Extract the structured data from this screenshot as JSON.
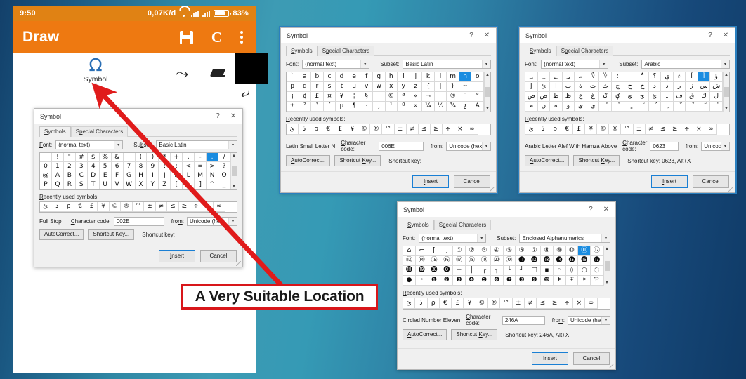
{
  "phone": {
    "status_bar": {
      "time": "9:50",
      "data_rate": "0,07K/d",
      "battery": "83%",
      "icons": [
        "wifi-icon",
        "signal-icon",
        "signal-icon",
        "battery-icon"
      ]
    },
    "app_bar": {
      "title": "Draw",
      "actions": [
        {
          "name": "save-icon"
        },
        {
          "name": "letter-c-icon",
          "label": "C"
        },
        {
          "name": "overflow-menu-icon"
        }
      ]
    },
    "toolbar": {
      "symbol_tool": {
        "glyph": "Ω",
        "label": "Symbol",
        "caret": "▾"
      },
      "redo": "⤳",
      "undo": "⤶",
      "eraser": "eraser-icon",
      "color_swatch": "#000000"
    }
  },
  "callout": {
    "text": "A Very Suitable Location",
    "border_color": "#d8161a",
    "arrow_color": "#e01b1b"
  },
  "dialog_common": {
    "title": "Symbol",
    "help_btn": "?",
    "close_btn": "✕",
    "tabs": [
      "Symbols",
      "Special Characters"
    ],
    "font_label": "Font:",
    "font_value": "(normal text)",
    "subset_label": "Subset:",
    "recently_used_label": "Recently used symbols:",
    "char_code_label": "Character code:",
    "from_label": "from:",
    "from_value": "Unicode (hex)",
    "autocorrect_btn": "AutoCorrect...",
    "shortcut_key_btn": "Shortcut Key...",
    "insert_btn": "Insert",
    "cancel_btn": "Cancel",
    "recently_used": [
      "ئ",
      "ذ",
      "ρ",
      "€",
      "£",
      "¥",
      "©",
      "®",
      "™",
      "±",
      "≠",
      "≤",
      "≥",
      "÷",
      "×",
      "∞"
    ]
  },
  "dialogs": [
    {
      "id": "dlg1",
      "subset_value": "Basic Latin",
      "columns": 16,
      "grid": [
        " ",
        "!",
        "\"",
        "#",
        "$",
        "%",
        "&",
        "'",
        "(",
        ")",
        "*",
        "+",
        ",",
        "-",
        ".",
        "/",
        "0",
        "1",
        "2",
        "3",
        "4",
        "5",
        "6",
        "7",
        "8",
        "9",
        ":",
        ";",
        "<",
        "=",
        ">",
        "?",
        "@",
        "A",
        "B",
        "C",
        "D",
        "E",
        "F",
        "G",
        "H",
        "I",
        "J",
        "K",
        "L",
        "M",
        "N",
        "O",
        "P",
        "Q",
        "R",
        "S",
        "T",
        "U",
        "V",
        "W",
        "X",
        "Y",
        "Z",
        "[",
        "\\",
        "]",
        "^",
        "_"
      ],
      "selected_index": 14,
      "char_name": "Full Stop",
      "char_code": "002E",
      "shortcut_key_label": "Shortcut key:"
    },
    {
      "id": "dlg2",
      "subset_value": "Basic Latin",
      "columns": 16,
      "grid": [
        "`",
        "a",
        "b",
        "c",
        "d",
        "e",
        "f",
        "g",
        "h",
        "i",
        "j",
        "k",
        "l",
        "m",
        "n",
        "o",
        "p",
        "q",
        "r",
        "s",
        "t",
        "u",
        "v",
        "w",
        "x",
        "y",
        "z",
        "{",
        "|",
        "}",
        "~",
        " ",
        "¡",
        "¢",
        "£",
        "¤",
        "¥",
        "¦",
        "§",
        "¨",
        "©",
        "ª",
        "«",
        "¬",
        "­",
        "®",
        "¯",
        "°",
        "±",
        "²",
        "³",
        "´",
        "µ",
        "¶",
        "·",
        "¸",
        "¹",
        "º",
        "»",
        "¼",
        "½",
        "¾",
        "¿",
        "À"
      ],
      "selected_index": 14,
      "char_name": "Latin Small Letter N",
      "char_code": "006E",
      "shortcut_key_label": "Shortcut key:"
    },
    {
      "id": "dlg3",
      "subset_value": "Arabic",
      "columns": 16,
      "grid": [
        "؀",
        "؁",
        "؂",
        "؃",
        "؄",
        "؆",
        "؇",
        "؛",
        "؜",
        "؞",
        "؟",
        "ؠ",
        "ء",
        "آ",
        "أ",
        "ؤ",
        "إ",
        "ئ",
        "ا",
        "ب",
        "ة",
        "ت",
        "ث",
        "ج",
        "ح",
        "خ",
        "د",
        "ذ",
        "ر",
        "ز",
        "س",
        "ش",
        "ص",
        "ض",
        "ط",
        "ظ",
        "ع",
        "غ",
        "ػ",
        "ؼ",
        "ؽ",
        "ؾ",
        "ؿ",
        "ـ",
        "ف",
        "ق",
        "ك",
        "ل",
        "م",
        "ن",
        "ه",
        "و",
        "ى",
        "ي",
        "ً",
        "ٌ",
        "ٍ",
        "َ",
        "ُ",
        "ِ",
        "ّ",
        "ْ",
        "ٓ",
        "ٔ"
      ],
      "selected_index": 14,
      "char_name": "Arabic Letter Alef With Hamza Above",
      "char_code": "0623",
      "shortcut_key_label": "Shortcut key: 0623, Alt+X"
    },
    {
      "id": "dlg4",
      "subset_value": "Enclosed Alphanumerics",
      "columns": 16,
      "grid": [
        "⌂",
        "⌐",
        "⌈",
        "⌋",
        "①",
        "②",
        "③",
        "④",
        "⑤",
        "⑥",
        "⑦",
        "⑧",
        "⑨",
        "⑩",
        "⑪",
        "⑫",
        "⑬",
        "⑭",
        "⑮",
        "⑯",
        "⑰",
        "⑱",
        "⑲",
        "⑳",
        "⓪",
        "⓫",
        "⓬",
        "⓭",
        "⓮",
        "⓯",
        "⓰",
        "⓱",
        "⓲",
        "⓳",
        "⓴",
        "⓿",
        "─",
        "│",
        "┌",
        "┐",
        "└",
        "┘",
        "□",
        "▪",
        "◦",
        "◊",
        "○",
        "◌",
        "●",
        "◦",
        "❶",
        "❷",
        "❸",
        "❹",
        "❺",
        "❻",
        "❼",
        "❽",
        "❾",
        "❿",
        "ŧ",
        "Ŧ",
        "ŧ",
        "Ƥ"
      ],
      "selected_index": 14,
      "char_name": "Circled Number Eleven",
      "char_code": "246A",
      "shortcut_key_label": "Shortcut key: 246A, Alt+X"
    }
  ]
}
